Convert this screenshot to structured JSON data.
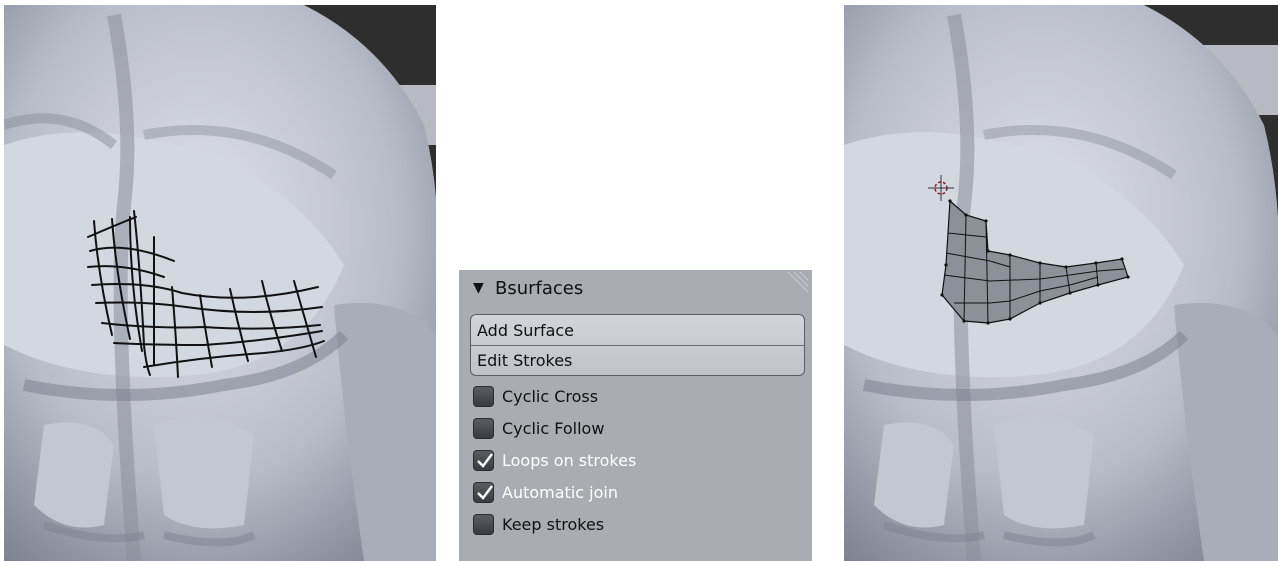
{
  "panel": {
    "title": "Bsurfaces",
    "collapse_icon": "triangle-down-icon",
    "buttons": [
      "Add Surface",
      "Edit Strokes"
    ],
    "options": [
      {
        "label": "Cyclic Cross",
        "checked": false
      },
      {
        "label": "Cyclic Follow",
        "checked": false
      },
      {
        "label": "Loops on strokes",
        "checked": true
      },
      {
        "label": "Automatic join",
        "checked": true
      },
      {
        "label": "Keep strokes",
        "checked": false
      }
    ]
  },
  "colors": {
    "panel_bg": "#a9acb0",
    "body_surface": "#c8ccd6",
    "stroke": "#111111",
    "mesh_face": "#8c9099",
    "cursor": "#8b1a1a"
  }
}
